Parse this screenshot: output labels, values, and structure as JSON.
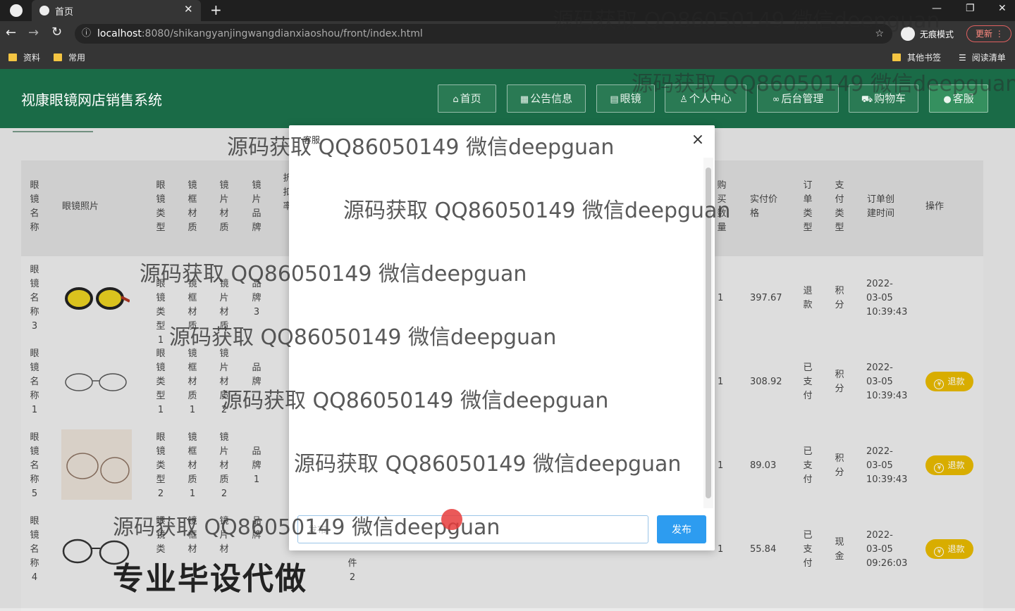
{
  "browser": {
    "tab_title": "首页",
    "url_host": "localhost",
    "url_rest": ":8080/shikangyanjingwangdianxiaoshou/front/index.html",
    "incognito_label": "无痕模式",
    "update_label": "更新",
    "bookmarks": [
      "资料",
      "常用"
    ],
    "other_bookmarks": "其他书签",
    "reading_list": "阅读清单"
  },
  "site": {
    "title": "视康眼镜网店销售系统",
    "nav": [
      {
        "label": "首页",
        "icon": "home-icon"
      },
      {
        "label": "公告信息",
        "icon": "grid-icon"
      },
      {
        "label": "眼镜",
        "icon": "apps-icon"
      },
      {
        "label": "个人中心",
        "icon": "user-icon"
      },
      {
        "label": "后台管理",
        "icon": "link-icon"
      },
      {
        "label": "购物车",
        "icon": "cart-icon"
      },
      {
        "label": "客服",
        "icon": "wechat-icon"
      }
    ]
  },
  "table": {
    "headers": {
      "name": "眼镜名称",
      "photo": "眼镜照片",
      "type": "眼镜类型",
      "frame": "镜框材质",
      "lens": "镜片材质",
      "brand": "镜片品牌",
      "discount": "折扣率",
      "qty": "购买数量",
      "paid": "实付价格",
      "order_type": "订单类型",
      "pay_type": "支付类型",
      "created": "订单创建时间",
      "actions": "操作"
    },
    "rows": [
      {
        "name": "眼镜名称3",
        "type": "眼镜类型1",
        "frame": "镜框材质",
        "lens": "镜片材质",
        "brand": "品牌3",
        "qty": "1",
        "paid": "397.67",
        "order_type": "退款",
        "pay_type": "积分",
        "created": "2022-03-05 10:39:43",
        "action": ""
      },
      {
        "name": "眼镜名称1",
        "type": "眼镜类型1",
        "frame": "镜框材质1",
        "lens": "镜片材质2",
        "brand": "品牌",
        "qty": "1",
        "paid": "308.92",
        "order_type": "已支付",
        "pay_type": "积分",
        "created": "2022-03-05 10:39:43",
        "action": "退款"
      },
      {
        "name": "眼镜名称5",
        "type": "眼镜类型2",
        "frame": "镜框材质1",
        "lens": "镜片材质2",
        "brand": "品牌1",
        "qty": "1",
        "paid": "89.03",
        "order_type": "已支付",
        "pay_type": "积分",
        "created": "2022-03-05 10:39:43",
        "action": "退款"
      },
      {
        "name": "眼镜名称4",
        "type": "眼镜类",
        "frame": "镜框材",
        "lens": "镜片材",
        "brand": "品牌",
        "extra": "件2",
        "qty": "1",
        "paid": "55.84",
        "order_type": "已支付",
        "pay_type": "现金",
        "created": "2022-03-05 09:26:03",
        "action": "退款"
      }
    ]
  },
  "modal": {
    "title": "客服",
    "close": "×",
    "input_placeholder": "发布",
    "send_label": "发布"
  },
  "watermark": {
    "text": "源码获取 QQ86050149 微信deepguan",
    "big_text": "专业毕设代做"
  }
}
